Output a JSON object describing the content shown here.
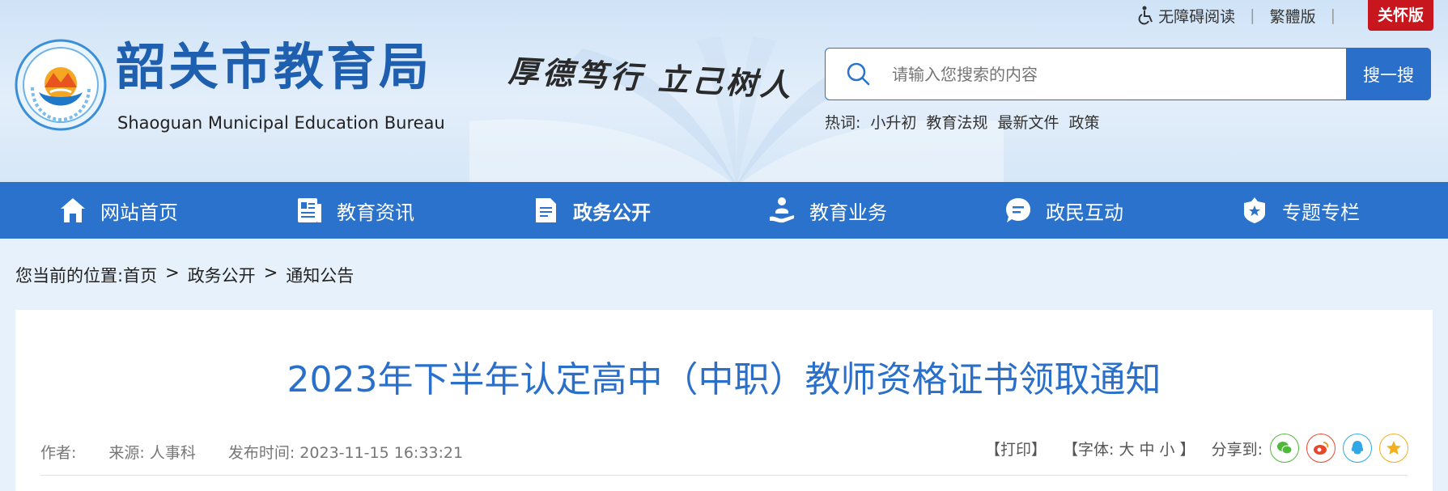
{
  "header": {
    "site_name_cn": "韶关市教育局",
    "site_name_en": "Shaoguan Municipal Education Bureau",
    "motto": "厚德笃行 立己树人",
    "top_links": {
      "accessibility": "无障碍阅读",
      "traditional": "繁體版",
      "care_mode": "关怀版"
    },
    "search": {
      "placeholder": "请输入您搜索的内容",
      "button": "搜一搜"
    },
    "hot": {
      "label": "热词:",
      "words": [
        "小升初",
        "教育法规",
        "最新文件",
        "政策"
      ]
    }
  },
  "nav": {
    "items": [
      {
        "label": "网站首页",
        "icon": "home-icon"
      },
      {
        "label": "教育资讯",
        "icon": "news-icon"
      },
      {
        "label": "政务公开",
        "icon": "document-icon"
      },
      {
        "label": "教育业务",
        "icon": "service-icon"
      },
      {
        "label": "政民互动",
        "icon": "chat-icon"
      },
      {
        "label": "专题专栏",
        "icon": "star-badge-icon"
      }
    ],
    "active": "政务公开"
  },
  "breadcrumb": {
    "prefix": "您当前的位置:",
    "items": [
      "首页",
      "政务公开",
      "通知公告"
    ]
  },
  "article": {
    "title": "2023年下半年认定高中（中职）教师资格证书领取通知",
    "author_label": "作者:",
    "source": "来源: 人事科",
    "publish_time": "发布时间: 2023-11-15 16:33:21",
    "print": "【打印】",
    "font_size": "【字体: 大 中 小 】",
    "share_label": "分享到:",
    "share_targets": [
      "wechat-icon",
      "weibo-icon",
      "qq-icon",
      "qzone-icon"
    ]
  },
  "colors": {
    "brand_blue": "#2a72cc",
    "care_red": "#c8161e",
    "title_blue": "#2a6fc9"
  }
}
